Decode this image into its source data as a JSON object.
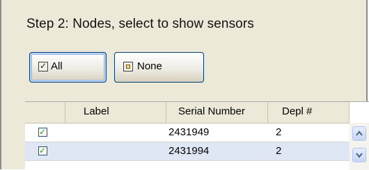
{
  "title": "Step 2: Nodes, select to show sensors",
  "buttons": {
    "all_label": "All",
    "none_label": "None"
  },
  "table": {
    "headers": [
      "",
      "Label",
      "Serial Number",
      "Depl #"
    ],
    "rows": [
      {
        "checked": true,
        "label": "",
        "serial": "2431949",
        "depl": "2"
      },
      {
        "checked": true,
        "label": "",
        "serial": "2431994",
        "depl": "2"
      }
    ]
  },
  "icons": {
    "all_button_icon": "checked-box-icon",
    "none_button_icon": "empty-box-icon",
    "scroll_up": "chevron-up-icon",
    "scroll_down": "chevron-down-icon"
  },
  "colors": {
    "panel_bg": "#ece9d8",
    "selected_row_bg": "#dfe7f5",
    "check_green": "#21a121",
    "button_focus": "#93b6ee"
  }
}
